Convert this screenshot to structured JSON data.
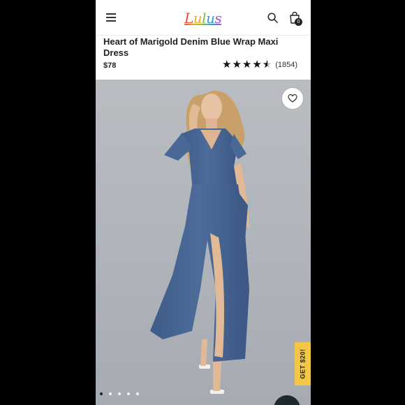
{
  "header": {
    "logo_text": "Lulus",
    "bag_count": "0"
  },
  "product": {
    "title": "Heart of Marigold Denim Blue Wrap Maxi Dress",
    "price": "$78",
    "rating_value": 4.5,
    "rating_max": 5,
    "review_count": "(1854)"
  },
  "hero": {
    "image_subject": "woman-in-blue-wrap-maxi-dress",
    "promo_label": "GET $20!",
    "carousel_dot_count": 5,
    "carousel_active_index": 0
  },
  "icons": {
    "menu": "hamburger-menu-icon",
    "search": "search-icon",
    "bag": "shopping-bag-icon",
    "favorite": "heart-icon",
    "chat": "chat-icon"
  },
  "colors": {
    "dress": "#4a6895",
    "background": "#b3b7bd",
    "promo": "#f3c64a",
    "star": "#111111"
  }
}
